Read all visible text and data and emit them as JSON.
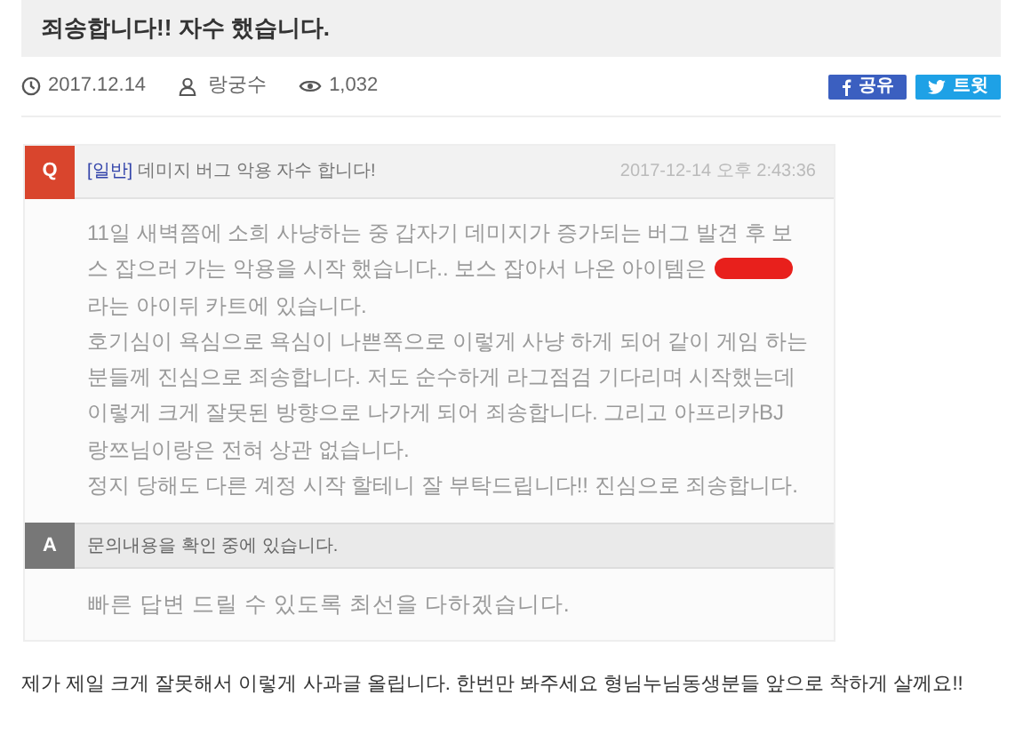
{
  "title": "죄송합니다!! 자수 했습니다.",
  "meta": {
    "date": "2017.12.14",
    "author": "랑궁수",
    "views": "1,032"
  },
  "share_buttons": [
    {
      "kind": "facebook",
      "label": "공유"
    },
    {
      "kind": "twitter",
      "label": "트윗"
    }
  ],
  "embedded_screenshot": {
    "question": {
      "badge": "Q",
      "category": "[일반]",
      "subject": "데미지 버그 악용 자수 합니다!",
      "timestamp": "2017-12-14 오후 2:43:36",
      "lines": [
        {
          "text": "11일 새벽쯤에 소희 사냥하는 중 갑자기 데미지가 증가되는 버그 발견 후 보",
          "redacted": false
        },
        {
          "text": "스 잡으러 가는 악용을 시작 했습니다.. 보스 잡아서 나온 아이템은",
          "redacted": true
        },
        {
          "text": "라는 아이뒤 카트에 있습니다.",
          "redacted": false
        },
        {
          "text": "호기심이 욕심으로 욕심이 나쁜쪽으로 이렇게 사냥 하게 되어 같이 게임 하는",
          "redacted": false
        },
        {
          "text": "분들께 진심으로 죄송합니다. 저도 순수하게 라그점검 기다리며 시작했는데",
          "redacted": false
        },
        {
          "text": "이렇게 크게 잘못된 방향으로 나가게 되어 죄송합니다. 그리고 아프리카BJ",
          "redacted": false
        },
        {
          "text": "랑쯔님이랑은 전혀 상관 없습니다.",
          "redacted": false
        },
        {
          "text": "정지 당해도 다른 계정 시작 할테니 잘 부탁드립니다!! 진심으로 죄송합니다.",
          "redacted": false
        }
      ]
    },
    "answer": {
      "badge": "A",
      "status": "문의내용을 확인 중에 있습니다.",
      "text": "빠른 답변 드릴 수 있도록 최선을 다하겠습니다."
    }
  },
  "body": "제가 제일 크게 잘못해서 이렇게 사과글 올립니다. 한번만 봐주세요 형님누님동생분들 앞으로 착하게 살께요!!"
}
